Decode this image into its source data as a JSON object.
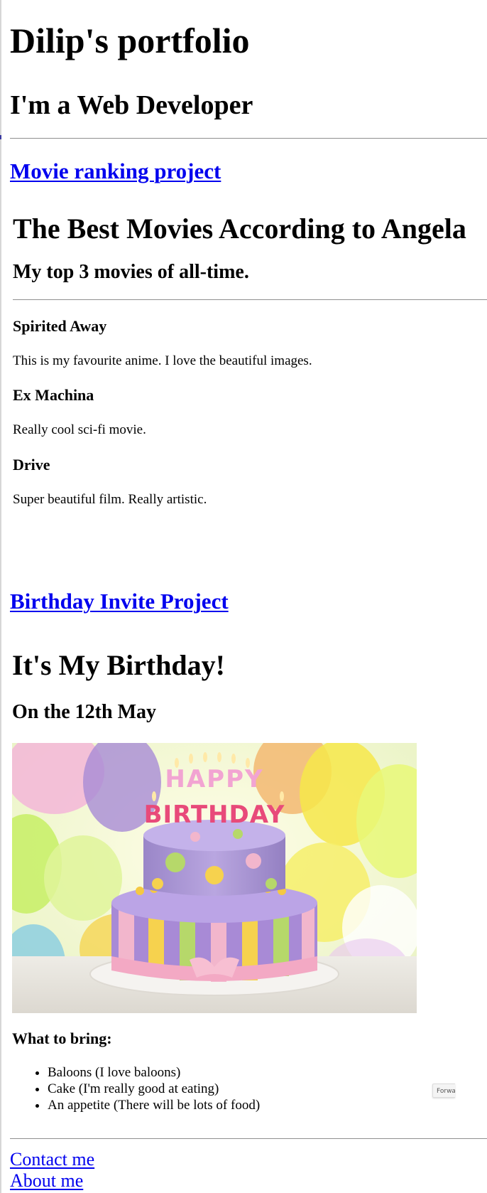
{
  "header": {
    "title": "Dilip's portfolio",
    "subtitle": "I'm a Web Developer"
  },
  "projects": [
    {
      "link_label": "Movie ranking project",
      "title": "The Best Movies According to Angela",
      "subtitle": "My top 3 movies of all-time.",
      "movies": [
        {
          "name": "Spirited Away",
          "description": "This is my favourite anime. I love the beautiful images."
        },
        {
          "name": "Ex Machina",
          "description": "Really cool sci-fi movie."
        },
        {
          "name": "Drive",
          "description": "Super beautiful film. Really artistic."
        }
      ]
    },
    {
      "link_label": "Birthday Invite Project",
      "title": "It's My Birthday!",
      "subtitle": "On the 12th May",
      "image_text": "HAPPY BIRTHDAY",
      "bring_heading": "What to bring:",
      "bring_items": [
        "Baloons (I love baloons)",
        "Cake (I'm really good at eating)",
        "An appetite (There will be lots of food)"
      ]
    }
  ],
  "overlay": {
    "forward_label": "Forward"
  },
  "footer": {
    "links": [
      "Contact me",
      "About me"
    ]
  },
  "colors": {
    "link": "#0000ee",
    "rule": "#8f8f8f"
  }
}
